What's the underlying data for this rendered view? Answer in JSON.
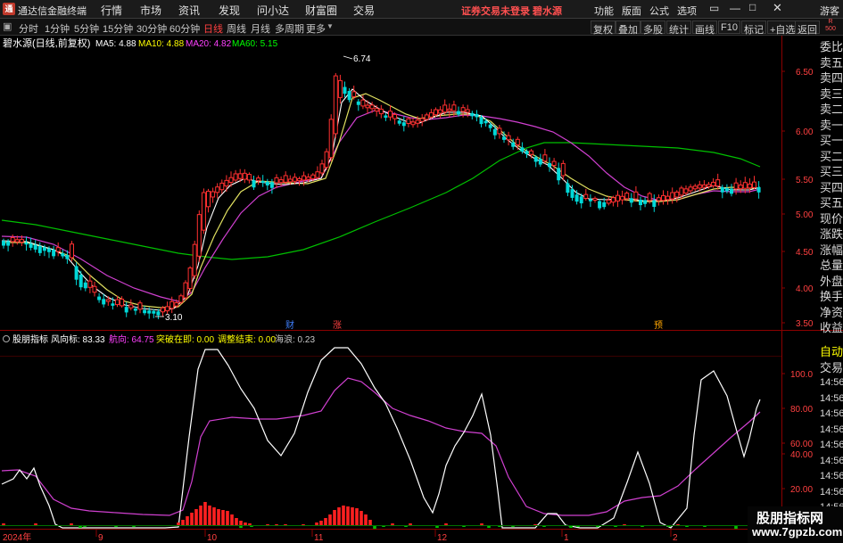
{
  "menubar": {
    "app_name": "通达信金融终端",
    "menus": [
      "行情",
      "市场",
      "资讯",
      "发现",
      "问小达",
      "财富圈",
      "交易"
    ],
    "warning": "证券交易未登录  碧水源",
    "right_menus": [
      "功能",
      "版面",
      "公式",
      "选项"
    ],
    "guest": "游客",
    "small_badge_top": "R",
    "small_badge_bottom": "500"
  },
  "toolbar": {
    "timeframes": [
      "分时",
      "1分钟",
      "5分钟",
      "15分钟",
      "30分钟",
      "60分钟",
      "日线",
      "周线",
      "月线",
      "多周期",
      "更多"
    ],
    "active_timeframe": "日线",
    "right_buttons": [
      "复权",
      "叠加",
      "多股",
      "统计",
      "画线",
      "F10",
      "标记",
      "+自选",
      "返回"
    ]
  },
  "main_chart": {
    "stock_title": "碧水源(日线,前复权)",
    "ma_labels": [
      {
        "label": "MA5: 4.88",
        "color": "#ffffff"
      },
      {
        "label": "MA10: 4.88",
        "color": "#ffff00"
      },
      {
        "label": "MA20: 4.82",
        "color": "#ff40ff"
      },
      {
        "label": "MA60: 5.15",
        "color": "#00ff00"
      }
    ],
    "price_axis": [
      "6.50",
      "6.00",
      "5.50",
      "5.00",
      "4.50",
      "4.00",
      "3.50"
    ],
    "high_label": "6.74",
    "low_label": "3.10",
    "event_marks": [
      {
        "text": "财",
        "color": "#4080ff"
      },
      {
        "text": "涨",
        "color": "#ff4040"
      },
      {
        "text": "预",
        "color": "#ffa500"
      }
    ]
  },
  "indicator": {
    "name": "股朋指标",
    "values": [
      {
        "label": "风向标: 83.33",
        "color": "#ffffff"
      },
      {
        "label": "航向: 64.75",
        "color": "#ff40ff"
      },
      {
        "label": "突破在即: 0.00",
        "color": "#ffff00"
      },
      {
        "label": "调整结束: 0.00",
        "color": "#ffff00"
      },
      {
        "label": "海浪: 0.23",
        "color": "#c8c8c8"
      }
    ],
    "axis": [
      "100.0",
      "80.00",
      "60.00",
      "40.00",
      "20.00"
    ]
  },
  "time_axis": [
    "2024年",
    "9",
    "10",
    "11",
    "12",
    "1",
    "2"
  ],
  "side_panel_top": [
    "委比",
    "卖五",
    "卖四",
    "卖三",
    "卖二",
    "卖一",
    "买一",
    "买二",
    "买三",
    "买四",
    "买五",
    "现价",
    "涨跌",
    "涨幅",
    "总量",
    "外盘",
    "换手",
    "净资",
    "收益"
  ],
  "side_panel_bottom": [
    "自动",
    "交易",
    "14:56",
    "14:56",
    "14:56",
    "14:56",
    "14:56",
    "14:56",
    "14:56",
    "14:56",
    "14:56"
  ],
  "watermark": {
    "line1": "股朋指标网",
    "line2": "www.7gpzb.com"
  }
}
